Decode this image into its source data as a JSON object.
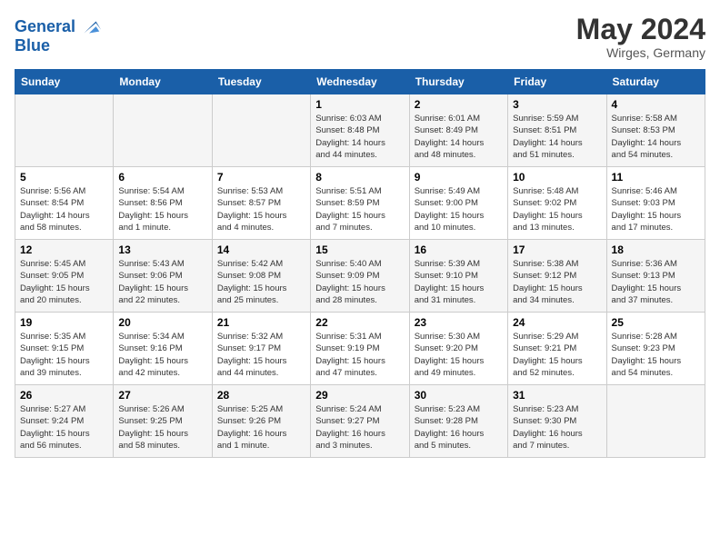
{
  "header": {
    "logo_line1": "General",
    "logo_line2": "Blue",
    "month_year": "May 2024",
    "location": "Wirges, Germany"
  },
  "weekdays": [
    "Sunday",
    "Monday",
    "Tuesday",
    "Wednesday",
    "Thursday",
    "Friday",
    "Saturday"
  ],
  "weeks": [
    [
      {
        "day": "",
        "info": ""
      },
      {
        "day": "",
        "info": ""
      },
      {
        "day": "",
        "info": ""
      },
      {
        "day": "1",
        "info": "Sunrise: 6:03 AM\nSunset: 8:48 PM\nDaylight: 14 hours\nand 44 minutes."
      },
      {
        "day": "2",
        "info": "Sunrise: 6:01 AM\nSunset: 8:49 PM\nDaylight: 14 hours\nand 48 minutes."
      },
      {
        "day": "3",
        "info": "Sunrise: 5:59 AM\nSunset: 8:51 PM\nDaylight: 14 hours\nand 51 minutes."
      },
      {
        "day": "4",
        "info": "Sunrise: 5:58 AM\nSunset: 8:53 PM\nDaylight: 14 hours\nand 54 minutes."
      }
    ],
    [
      {
        "day": "5",
        "info": "Sunrise: 5:56 AM\nSunset: 8:54 PM\nDaylight: 14 hours\nand 58 minutes."
      },
      {
        "day": "6",
        "info": "Sunrise: 5:54 AM\nSunset: 8:56 PM\nDaylight: 15 hours\nand 1 minute."
      },
      {
        "day": "7",
        "info": "Sunrise: 5:53 AM\nSunset: 8:57 PM\nDaylight: 15 hours\nand 4 minutes."
      },
      {
        "day": "8",
        "info": "Sunrise: 5:51 AM\nSunset: 8:59 PM\nDaylight: 15 hours\nand 7 minutes."
      },
      {
        "day": "9",
        "info": "Sunrise: 5:49 AM\nSunset: 9:00 PM\nDaylight: 15 hours\nand 10 minutes."
      },
      {
        "day": "10",
        "info": "Sunrise: 5:48 AM\nSunset: 9:02 PM\nDaylight: 15 hours\nand 13 minutes."
      },
      {
        "day": "11",
        "info": "Sunrise: 5:46 AM\nSunset: 9:03 PM\nDaylight: 15 hours\nand 17 minutes."
      }
    ],
    [
      {
        "day": "12",
        "info": "Sunrise: 5:45 AM\nSunset: 9:05 PM\nDaylight: 15 hours\nand 20 minutes."
      },
      {
        "day": "13",
        "info": "Sunrise: 5:43 AM\nSunset: 9:06 PM\nDaylight: 15 hours\nand 22 minutes."
      },
      {
        "day": "14",
        "info": "Sunrise: 5:42 AM\nSunset: 9:08 PM\nDaylight: 15 hours\nand 25 minutes."
      },
      {
        "day": "15",
        "info": "Sunrise: 5:40 AM\nSunset: 9:09 PM\nDaylight: 15 hours\nand 28 minutes."
      },
      {
        "day": "16",
        "info": "Sunrise: 5:39 AM\nSunset: 9:10 PM\nDaylight: 15 hours\nand 31 minutes."
      },
      {
        "day": "17",
        "info": "Sunrise: 5:38 AM\nSunset: 9:12 PM\nDaylight: 15 hours\nand 34 minutes."
      },
      {
        "day": "18",
        "info": "Sunrise: 5:36 AM\nSunset: 9:13 PM\nDaylight: 15 hours\nand 37 minutes."
      }
    ],
    [
      {
        "day": "19",
        "info": "Sunrise: 5:35 AM\nSunset: 9:15 PM\nDaylight: 15 hours\nand 39 minutes."
      },
      {
        "day": "20",
        "info": "Sunrise: 5:34 AM\nSunset: 9:16 PM\nDaylight: 15 hours\nand 42 minutes."
      },
      {
        "day": "21",
        "info": "Sunrise: 5:32 AM\nSunset: 9:17 PM\nDaylight: 15 hours\nand 44 minutes."
      },
      {
        "day": "22",
        "info": "Sunrise: 5:31 AM\nSunset: 9:19 PM\nDaylight: 15 hours\nand 47 minutes."
      },
      {
        "day": "23",
        "info": "Sunrise: 5:30 AM\nSunset: 9:20 PM\nDaylight: 15 hours\nand 49 minutes."
      },
      {
        "day": "24",
        "info": "Sunrise: 5:29 AM\nSunset: 9:21 PM\nDaylight: 15 hours\nand 52 minutes."
      },
      {
        "day": "25",
        "info": "Sunrise: 5:28 AM\nSunset: 9:23 PM\nDaylight: 15 hours\nand 54 minutes."
      }
    ],
    [
      {
        "day": "26",
        "info": "Sunrise: 5:27 AM\nSunset: 9:24 PM\nDaylight: 15 hours\nand 56 minutes."
      },
      {
        "day": "27",
        "info": "Sunrise: 5:26 AM\nSunset: 9:25 PM\nDaylight: 15 hours\nand 58 minutes."
      },
      {
        "day": "28",
        "info": "Sunrise: 5:25 AM\nSunset: 9:26 PM\nDaylight: 16 hours\nand 1 minute."
      },
      {
        "day": "29",
        "info": "Sunrise: 5:24 AM\nSunset: 9:27 PM\nDaylight: 16 hours\nand 3 minutes."
      },
      {
        "day": "30",
        "info": "Sunrise: 5:23 AM\nSunset: 9:28 PM\nDaylight: 16 hours\nand 5 minutes."
      },
      {
        "day": "31",
        "info": "Sunrise: 5:23 AM\nSunset: 9:30 PM\nDaylight: 16 hours\nand 7 minutes."
      },
      {
        "day": "",
        "info": ""
      }
    ]
  ]
}
